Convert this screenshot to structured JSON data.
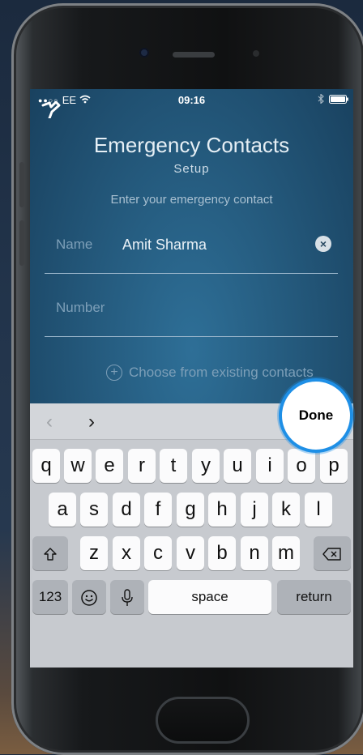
{
  "status_bar": {
    "carrier": "EE",
    "time": "09:16"
  },
  "header": {
    "title": "Emergency Contacts",
    "subtitle": "Setup",
    "instruction": "Enter your emergency contact"
  },
  "form": {
    "name_label": "Name",
    "name_value": "Amit Sharma",
    "number_label": "Number",
    "number_value": ""
  },
  "choose_existing_label": "Choose from existing contacts",
  "keyboard_toolbar": {
    "done_label": "Done"
  },
  "keyboard": {
    "row1": [
      "q",
      "w",
      "e",
      "r",
      "t",
      "y",
      "u",
      "i",
      "o",
      "p"
    ],
    "row2": [
      "a",
      "s",
      "d",
      "f",
      "g",
      "h",
      "j",
      "k",
      "l"
    ],
    "row3": [
      "z",
      "x",
      "c",
      "v",
      "b",
      "n",
      "m"
    ],
    "numbers_label": "123",
    "space_label": "space",
    "return_label": "return"
  },
  "colors": {
    "highlight_ring": "#1e8fe6",
    "accent": "#2e6f97"
  },
  "icons": [
    "signal-icon",
    "wifi-icon",
    "bluetooth-icon",
    "battery-icon",
    "back-icon",
    "clear-icon",
    "plus-circle-icon",
    "chevron-left-icon",
    "chevron-right-icon",
    "shift-icon",
    "emoji-icon",
    "microphone-icon",
    "backspace-icon"
  ]
}
